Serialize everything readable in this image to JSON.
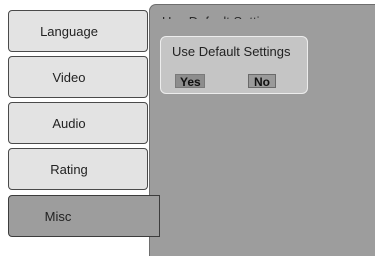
{
  "menu": {
    "tabs": [
      {
        "label": "Language"
      },
      {
        "label": "Video"
      },
      {
        "label": "Audio"
      },
      {
        "label": "Rating"
      },
      {
        "label": "Misc"
      }
    ],
    "active_tab": "Misc"
  },
  "panel": {
    "heading": "Use Default Settings"
  },
  "dialog": {
    "title": "Use Default Settings",
    "yes_label": "Yes",
    "no_label": "No"
  },
  "colors": {
    "panel_bg": "#9d9d9d",
    "tab_bg": "#e3e3e3",
    "dialog_bg": "#c5c5c5"
  }
}
